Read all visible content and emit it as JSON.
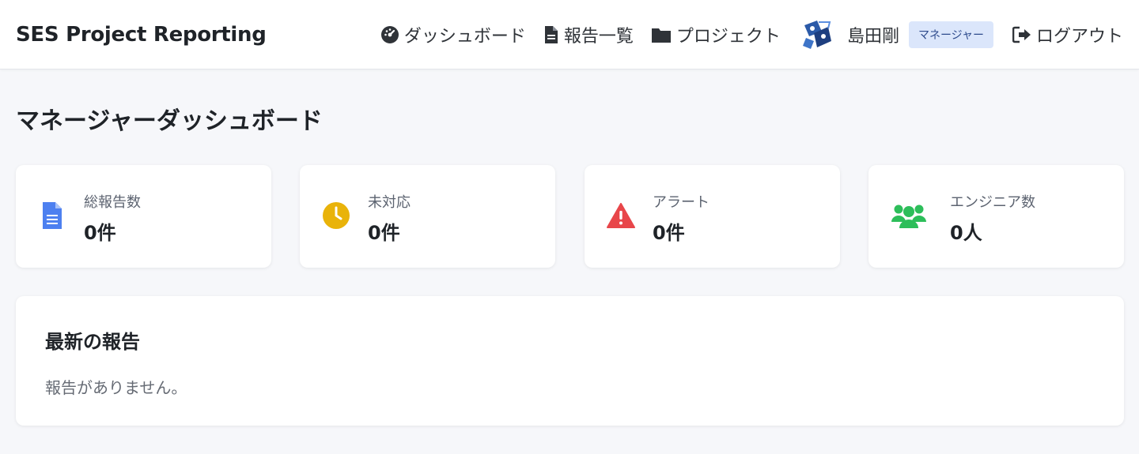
{
  "header": {
    "brand": "SES Project Reporting",
    "nav": [
      {
        "label": "ダッシュボード",
        "icon": "dashboard-gauge-icon"
      },
      {
        "label": "報告一覧",
        "icon": "document-icon"
      },
      {
        "label": "プロジェクト",
        "icon": "folder-icon"
      }
    ],
    "user": {
      "name": "島田剛",
      "role": "マネージャー",
      "avatar": "user-avatar"
    },
    "logout_label": "ログアウト"
  },
  "page": {
    "title": "マネージャーダッシュボード"
  },
  "stats": [
    {
      "label": "総報告数",
      "value": "0件",
      "icon": "document-icon",
      "color": "#4d80f0"
    },
    {
      "label": "未対応",
      "value": "0件",
      "icon": "clock-icon",
      "color": "#e9b30a"
    },
    {
      "label": "アラート",
      "value": "0件",
      "icon": "warning-icon",
      "color": "#e8464a"
    },
    {
      "label": "エンジニア数",
      "value": "0人",
      "icon": "users-icon",
      "color": "#2dbe5a"
    }
  ],
  "recent": {
    "title": "最新の報告",
    "empty_message": "報告がありません。"
  }
}
